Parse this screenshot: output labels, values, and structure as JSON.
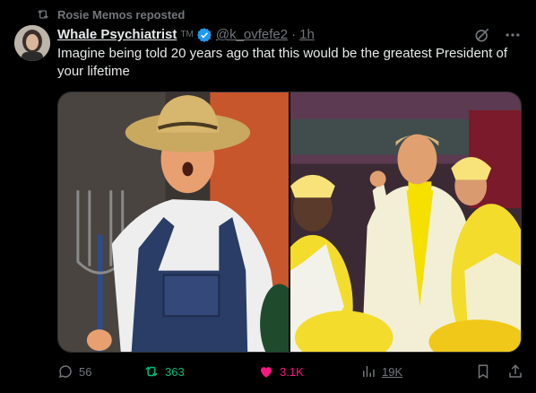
{
  "repost": {
    "label": "Rosie Memos reposted",
    "icon": "repost-icon"
  },
  "author": {
    "display_name": "Whale Psychiatrist",
    "tm": "TM",
    "handle": "@k_ovfefe2",
    "separator": "·",
    "time": "1h",
    "verified": true,
    "verified_color": "#1d9bf0"
  },
  "tweet": {
    "text": "Imagine being told 20 years ago that this would be the greatest President of your lifetime"
  },
  "media": {
    "images": [
      "photo-farmer-costume",
      "photo-chicken-costume-stage"
    ]
  },
  "actions": {
    "replies": "56",
    "reposts": "363",
    "likes": "3.1K",
    "views": "19K"
  },
  "colors": {
    "background": "#000000",
    "text": "#e7e9ea",
    "muted": "#71767b",
    "repost_active": "#00ba7c",
    "like_active": "#f91880",
    "accent": "#1d9bf0"
  }
}
